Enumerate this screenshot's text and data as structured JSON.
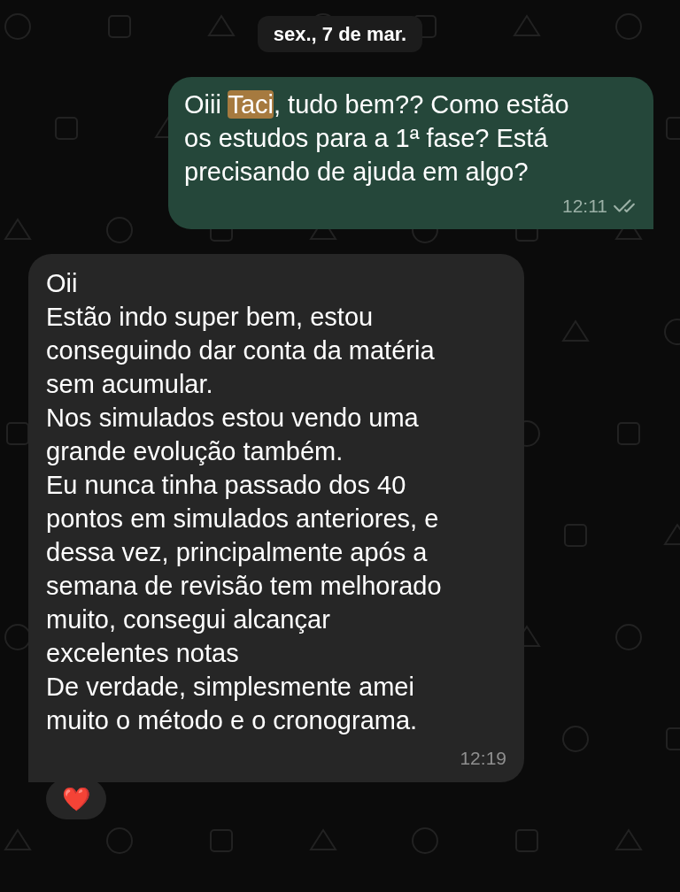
{
  "date_label": "sex., 7 de mar.",
  "messages": [
    {
      "kind": "sent",
      "parts": [
        {
          "text": "Oiii ",
          "mention": false
        },
        {
          "text": "Taci",
          "mention": true
        },
        {
          "text": ", tudo bem?? Como estão os estudos para a 1ª fase? Está precisando de ajuda em algo?",
          "mention": false
        }
      ],
      "time": "12:11",
      "read": true
    },
    {
      "kind": "received",
      "paragraphs": [
        "Oii",
        "Estão indo super bem, estou conseguindo dar conta da matéria sem acumular.",
        "Nos simulados estou vendo uma grande evolução também.",
        "Eu nunca tinha passado dos 40 pontos em simulados anteriores, e dessa vez, principalmente após a semana de revisão tem melhorado muito, consegui alcançar excelentes notas",
        "De verdade, simplesmente amei muito o método e o cronograma."
      ],
      "time": "12:19",
      "reaction": "❤️"
    }
  ]
}
